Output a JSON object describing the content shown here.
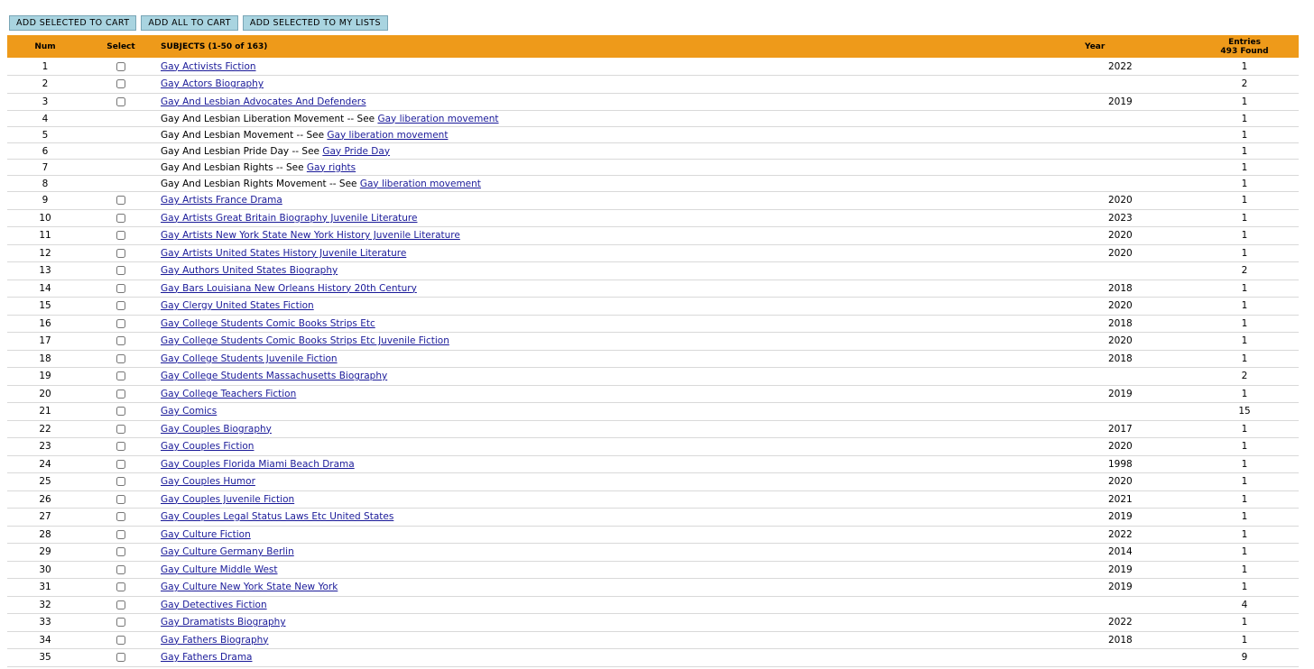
{
  "toolbar": {
    "add_selected_to_cart": "ADD SELECTED TO CART",
    "add_all_to_cart": "ADD ALL TO CART",
    "add_selected_to_lists": "ADD SELECTED TO MY LISTS"
  },
  "table": {
    "headers": {
      "num": "Num",
      "select": "Select",
      "subjects": "SUBJECTS (1-50 of 163)",
      "year": "Year",
      "entries": "Entries",
      "found": "493 Found"
    },
    "see_text": " -- See ",
    "rows": [
      {
        "num": "1",
        "subject": "Gay Activists Fiction",
        "year": "2022",
        "entries": "1"
      },
      {
        "num": "2",
        "subject": "Gay Actors Biography",
        "year": "",
        "entries": "2"
      },
      {
        "num": "3",
        "subject": "Gay And Lesbian Advocates And Defenders",
        "year": "2019",
        "entries": "1"
      },
      {
        "num": "4",
        "subject": "Gay And Lesbian Liberation Movement",
        "see": "Gay liberation movement",
        "year": "",
        "entries": "1"
      },
      {
        "num": "5",
        "subject": "Gay And Lesbian Movement",
        "see": "Gay liberation movement",
        "year": "",
        "entries": "1"
      },
      {
        "num": "6",
        "subject": "Gay And Lesbian Pride Day",
        "see": "Gay Pride Day",
        "year": "",
        "entries": "1"
      },
      {
        "num": "7",
        "subject": "Gay And Lesbian Rights",
        "see": "Gay rights",
        "year": "",
        "entries": "1"
      },
      {
        "num": "8",
        "subject": "Gay And Lesbian Rights Movement",
        "see": "Gay liberation movement",
        "year": "",
        "entries": "1"
      },
      {
        "num": "9",
        "subject": "Gay Artists France Drama",
        "year": "2020",
        "entries": "1"
      },
      {
        "num": "10",
        "subject": "Gay Artists Great Britain Biography Juvenile Literature",
        "year": "2023",
        "entries": "1"
      },
      {
        "num": "11",
        "subject": "Gay Artists New York State New York History Juvenile Literature",
        "year": "2020",
        "entries": "1"
      },
      {
        "num": "12",
        "subject": "Gay Artists United States History Juvenile Literature",
        "year": "2020",
        "entries": "1"
      },
      {
        "num": "13",
        "subject": "Gay Authors United States Biography",
        "year": "",
        "entries": "2"
      },
      {
        "num": "14",
        "subject": "Gay Bars Louisiana New Orleans History 20th Century",
        "year": "2018",
        "entries": "1"
      },
      {
        "num": "15",
        "subject": "Gay Clergy United States Fiction",
        "year": "2020",
        "entries": "1"
      },
      {
        "num": "16",
        "subject": "Gay College Students Comic Books Strips Etc",
        "year": "2018",
        "entries": "1"
      },
      {
        "num": "17",
        "subject": "Gay College Students Comic Books Strips Etc Juvenile Fiction",
        "year": "2020",
        "entries": "1"
      },
      {
        "num": "18",
        "subject": "Gay College Students Juvenile Fiction",
        "year": "2018",
        "entries": "1"
      },
      {
        "num": "19",
        "subject": "Gay College Students Massachusetts Biography",
        "year": "",
        "entries": "2"
      },
      {
        "num": "20",
        "subject": "Gay College Teachers Fiction",
        "year": "2019",
        "entries": "1"
      },
      {
        "num": "21",
        "subject": "Gay Comics",
        "year": "",
        "entries": "15"
      },
      {
        "num": "22",
        "subject": "Gay Couples Biography",
        "year": "2017",
        "entries": "1"
      },
      {
        "num": "23",
        "subject": "Gay Couples Fiction",
        "year": "2020",
        "entries": "1"
      },
      {
        "num": "24",
        "subject": "Gay Couples Florida Miami Beach Drama",
        "year": "1998",
        "entries": "1"
      },
      {
        "num": "25",
        "subject": "Gay Couples Humor",
        "year": "2020",
        "entries": "1"
      },
      {
        "num": "26",
        "subject": "Gay Couples Juvenile Fiction",
        "year": "2021",
        "entries": "1"
      },
      {
        "num": "27",
        "subject": "Gay Couples Legal Status Laws Etc United States",
        "year": "2019",
        "entries": "1"
      },
      {
        "num": "28",
        "subject": "Gay Culture Fiction",
        "year": "2022",
        "entries": "1"
      },
      {
        "num": "29",
        "subject": "Gay Culture Germany Berlin",
        "year": "2014",
        "entries": "1"
      },
      {
        "num": "30",
        "subject": "Gay Culture Middle West",
        "year": "2019",
        "entries": "1"
      },
      {
        "num": "31",
        "subject": "Gay Culture New York State New York",
        "year": "2019",
        "entries": "1"
      },
      {
        "num": "32",
        "subject": "Gay Detectives Fiction",
        "year": "",
        "entries": "4"
      },
      {
        "num": "33",
        "subject": "Gay Dramatists Biography",
        "year": "2022",
        "entries": "1"
      },
      {
        "num": "34",
        "subject": "Gay Fathers Biography",
        "year": "2018",
        "entries": "1"
      },
      {
        "num": "35",
        "subject": "Gay Fathers Drama",
        "year": "",
        "entries": "9"
      }
    ]
  }
}
